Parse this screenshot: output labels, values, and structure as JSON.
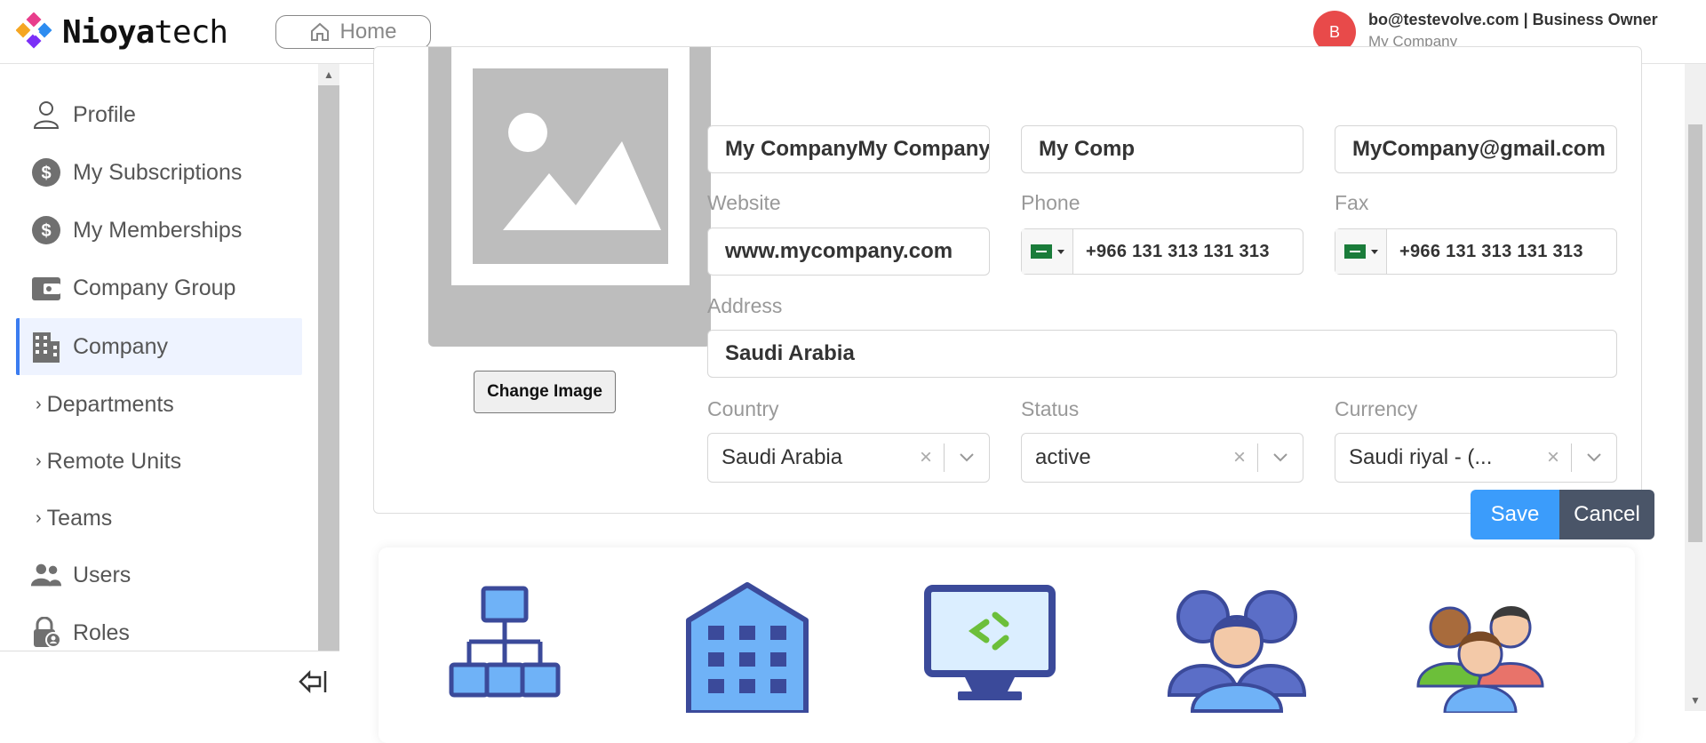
{
  "header": {
    "logo_bold": "Nioya",
    "logo_light": "tech",
    "home_label": "Home",
    "avatar_initial": "B",
    "user_email_role": "bo@testevolve.com | Business Owner",
    "user_company": "My Company"
  },
  "sidebar": {
    "items": [
      {
        "label": "Profile",
        "icon": "user-icon"
      },
      {
        "label": "My Subscriptions",
        "icon": "dollar-icon"
      },
      {
        "label": "My Memberships",
        "icon": "dollar-icon"
      },
      {
        "label": "Company Group",
        "icon": "wallet-icon"
      },
      {
        "label": "Company",
        "icon": "building-icon",
        "active": true
      }
    ],
    "subitems": [
      {
        "label": "Departments"
      },
      {
        "label": "Remote Units"
      },
      {
        "label": "Teams"
      }
    ],
    "items_bottom": [
      {
        "label": "Users",
        "icon": "users-icon"
      },
      {
        "label": "Roles",
        "icon": "lock-user-icon"
      }
    ]
  },
  "form": {
    "company_name": "My CompanyMy Company",
    "short_name": "My Comp",
    "email": "MyCompany@gmail.com",
    "website_label": "Website",
    "website": "www.mycompany.com",
    "phone_label": "Phone",
    "phone": "+966 131 313 131 313",
    "fax_label": "Fax",
    "fax": "+966 131 313 131 313",
    "address_label": "Address",
    "address": "Saudi Arabia",
    "country_label": "Country",
    "country": "Saudi Arabia",
    "status_label": "Status",
    "status": "active",
    "currency_label": "Currency",
    "currency": "Saudi riyal - (...",
    "change_image": "Change Image",
    "save": "Save",
    "cancel": "Cancel"
  },
  "tiles": [
    {
      "icon": "org-chart-icon"
    },
    {
      "icon": "building-icon"
    },
    {
      "icon": "remote-monitor-icon"
    },
    {
      "icon": "team-icon"
    },
    {
      "icon": "users-group-icon"
    }
  ]
}
